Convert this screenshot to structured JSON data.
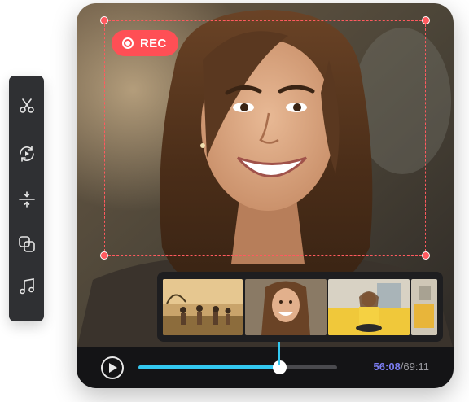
{
  "toolbar": {
    "tools": [
      {
        "icon": "scissors-icon",
        "name": "tool-cut"
      },
      {
        "icon": "rotate-play-icon",
        "name": "tool-loop"
      },
      {
        "icon": "split-icon",
        "name": "tool-split"
      },
      {
        "icon": "overlay-icon",
        "name": "tool-overlay"
      },
      {
        "icon": "music-note-icon",
        "name": "tool-music"
      }
    ]
  },
  "recording": {
    "label": "REC",
    "color": "#ff4f55"
  },
  "player": {
    "current_time": "56:08",
    "separator": "/",
    "total_time": "69:11",
    "progress_fraction": 0.71,
    "accent_color": "#33c8f0"
  },
  "filmstrip": {
    "thumbnails": [
      "people-running-thumbnail",
      "smiling-woman-thumbnail",
      "woman-on-couch-thumbnail",
      "room-thumbnail"
    ]
  }
}
